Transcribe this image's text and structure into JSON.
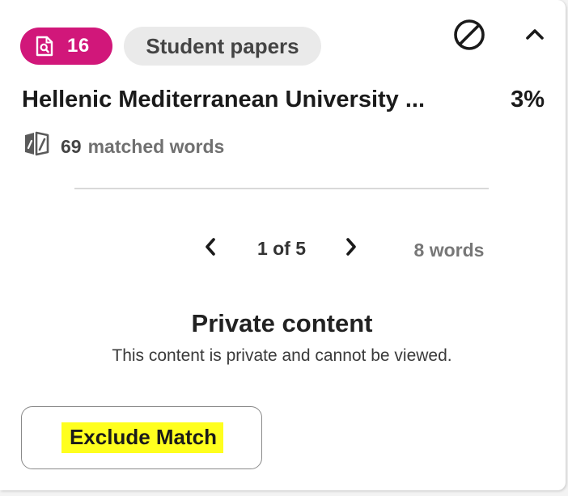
{
  "colors": {
    "source_badge_bg": "#d1177a",
    "type_badge_bg": "#eaeaea",
    "highlight": "#ffff1e"
  },
  "header": {
    "source_icon": "document-search-icon",
    "source_number": "16",
    "source_type": "Student papers",
    "block_icon": "block-icon",
    "collapse_icon": "chevron-up-icon"
  },
  "source": {
    "title": "Hellenic Mediterranean University ...",
    "percent": "3%"
  },
  "matched": {
    "icon": "matched-words-icon",
    "count": "69",
    "label": "matched words"
  },
  "pager": {
    "prev_icon": "chevron-left-icon",
    "next_icon": "chevron-right-icon",
    "indicator": "1 of 5",
    "words": "8 words"
  },
  "private": {
    "title": "Private content",
    "description": "This content is private and cannot be viewed."
  },
  "actions": {
    "exclude_label": "Exclude Match"
  }
}
